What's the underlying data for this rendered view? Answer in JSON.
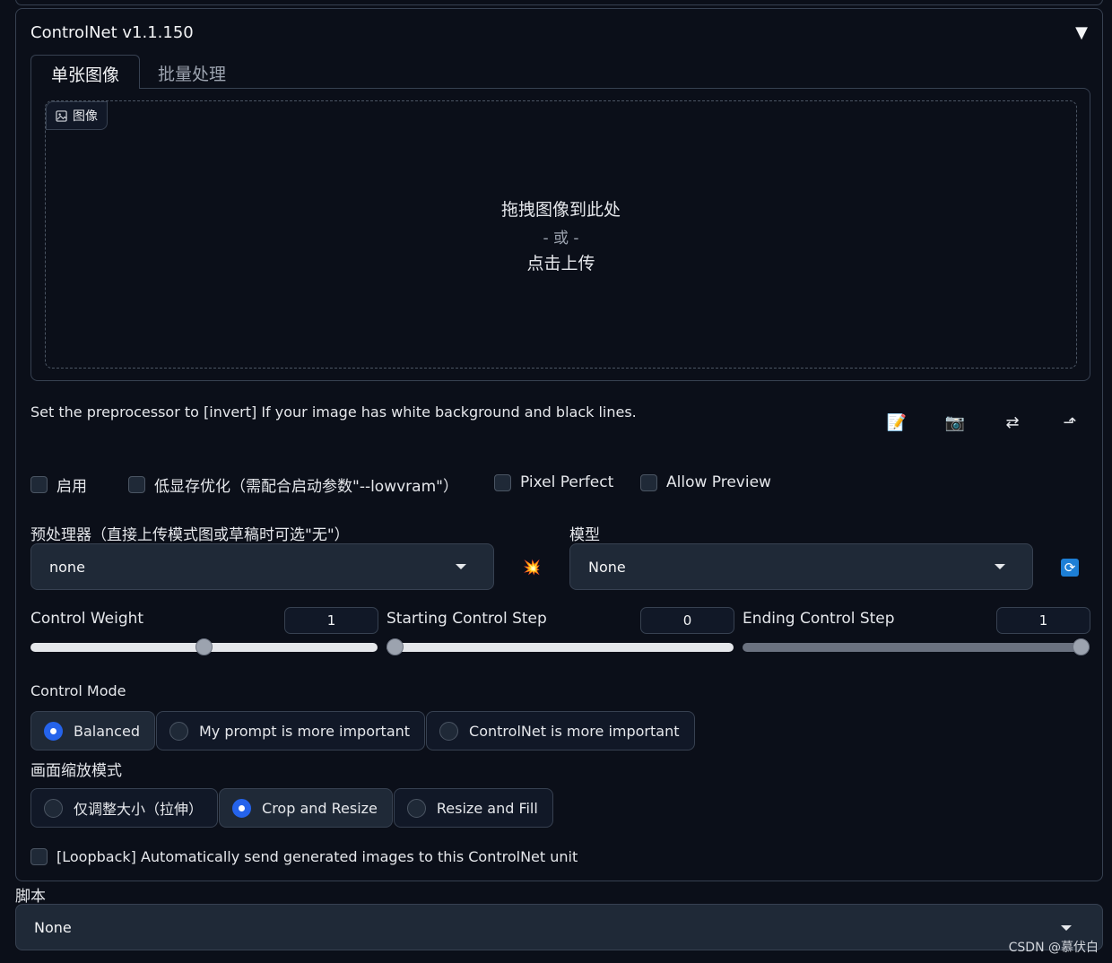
{
  "panel": {
    "title": "ControlNet v1.1.150",
    "collapse_icon": "▼"
  },
  "tabs": [
    {
      "label": "单张图像",
      "active": true
    },
    {
      "label": "批量处理",
      "active": false
    }
  ],
  "image_upload": {
    "label": "图像",
    "drop_text": "拖拽图像到此处",
    "or_text": "- 或 -",
    "click_text": "点击上传"
  },
  "hint": "Set the preprocessor to [invert] If your image has white background and black lines.",
  "tools": {
    "notepad": "📝",
    "camera": "📷",
    "swap": "⇄",
    "send": "⬏"
  },
  "checkboxes": [
    {
      "label": "启用",
      "checked": false
    },
    {
      "label": "低显存优化（需配合启动参数\"--lowvram\"）",
      "checked": false
    },
    {
      "label": "Pixel Perfect",
      "checked": false
    },
    {
      "label": "Allow Preview",
      "checked": false
    }
  ],
  "preprocessor": {
    "label": "预处理器（直接上传模式图或草稿时可选\"无\"）",
    "value": "none",
    "run_icon": "💥"
  },
  "model": {
    "label": "模型",
    "value": "None",
    "refresh_icon": "🔄"
  },
  "sliders": [
    {
      "label": "Control Weight",
      "value": "1",
      "fraction": 0.5
    },
    {
      "label": "Starting Control Step",
      "value": "0",
      "fraction": 0.0
    },
    {
      "label": "Ending Control Step",
      "value": "1",
      "fraction": 1.0
    }
  ],
  "control_mode": {
    "label": "Control Mode",
    "options": [
      "Balanced",
      "My prompt is more important",
      "ControlNet is more important"
    ],
    "selected": 0
  },
  "resize_mode": {
    "label": "画面缩放模式",
    "options": [
      "仅调整大小（拉伸）",
      "Crop and Resize",
      "Resize and Fill"
    ],
    "selected": 1
  },
  "loopback": {
    "label": "[Loopback] Automatically send generated images to this ControlNet unit",
    "checked": false
  },
  "script": {
    "label": "脚本",
    "value": "None"
  },
  "watermark": "CSDN @慕伏白",
  "colors": {
    "background": "#0b0f19",
    "accent": "#2563eb",
    "border": "#374151"
  }
}
